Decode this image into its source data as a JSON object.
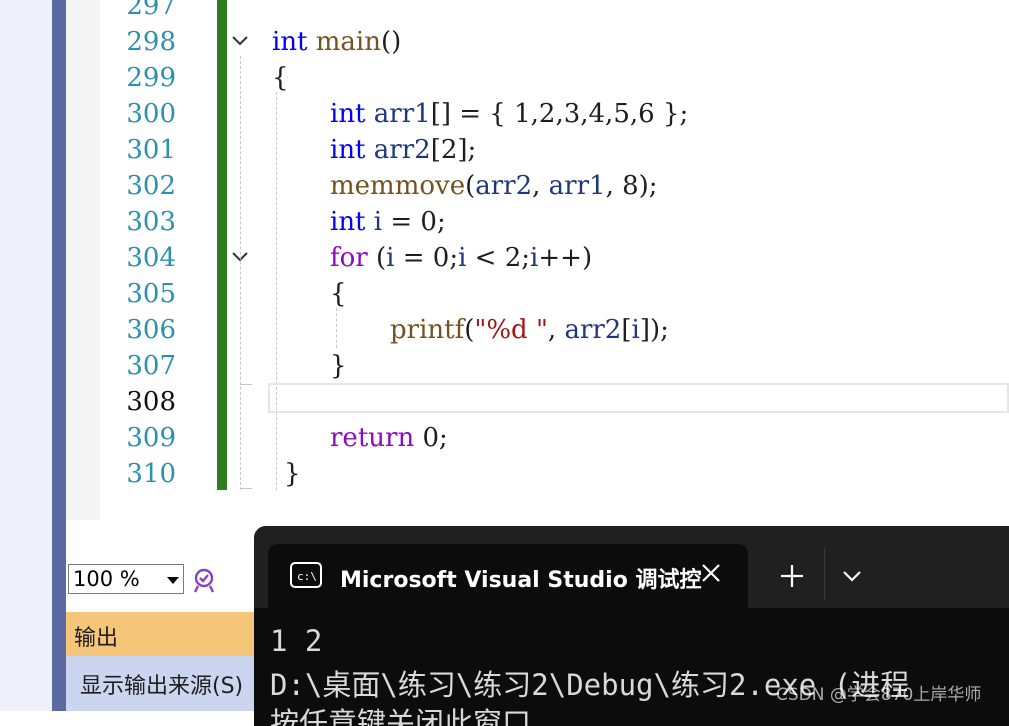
{
  "editor": {
    "line_numbers": [
      "297",
      "298",
      "299",
      "300",
      "301",
      "302",
      "303",
      "304",
      "305",
      "306",
      "307",
      "308",
      "309",
      "310"
    ],
    "active_line": "308",
    "code": {
      "l298": {
        "kw": "int",
        "fn": "main",
        "rest": "()"
      },
      "l299": {
        "text": "{"
      },
      "l300": {
        "kw": "int",
        "var": "arr1",
        "rest": "[] = { 1,2,3,4,5,6 };"
      },
      "l301": {
        "kw": "int",
        "var": "arr2",
        "rest": "[2];"
      },
      "l302": {
        "fn": "memmove",
        "p1": "(",
        "a1": "arr2",
        ",": ", ",
        "a2": "arr1",
        "rest": ", 8);"
      },
      "l303": {
        "kw": "int",
        "var": "i",
        "rest": " = 0;"
      },
      "l304": {
        "kw": "for",
        "p1": " (",
        "a1": "i",
        " r1": " = 0;",
        "a2": "i",
        "r2": " < 2;",
        "a3": "i",
        "r3": "++)"
      },
      "l305": {
        "text": "{"
      },
      "l306": {
        "fn": "printf",
        "p1": "(",
        "str": "\"%d \"",
        "c": ", ",
        "var": "arr2",
        "p2": "[",
        "idx": "i",
        "rest": "]);"
      },
      "l307": {
        "text": "}"
      },
      "l309": {
        "kw": "return",
        "rest": " 0;"
      },
      "l310": {
        "text": "}"
      }
    }
  },
  "zoom": {
    "value": "100 %"
  },
  "output_panel": {
    "title": "输出",
    "source_label": "显示输出来源(S)"
  },
  "terminal": {
    "tab_title": "Microsoft Visual Studio 调试控",
    "lines": [
      "1 2",
      "D:\\桌面\\练习\\练习2\\Debug\\练习2.exe (进程",
      "按任意键关闭此窗口"
    ]
  },
  "watermark": "CSDN @学会870上岸华师"
}
